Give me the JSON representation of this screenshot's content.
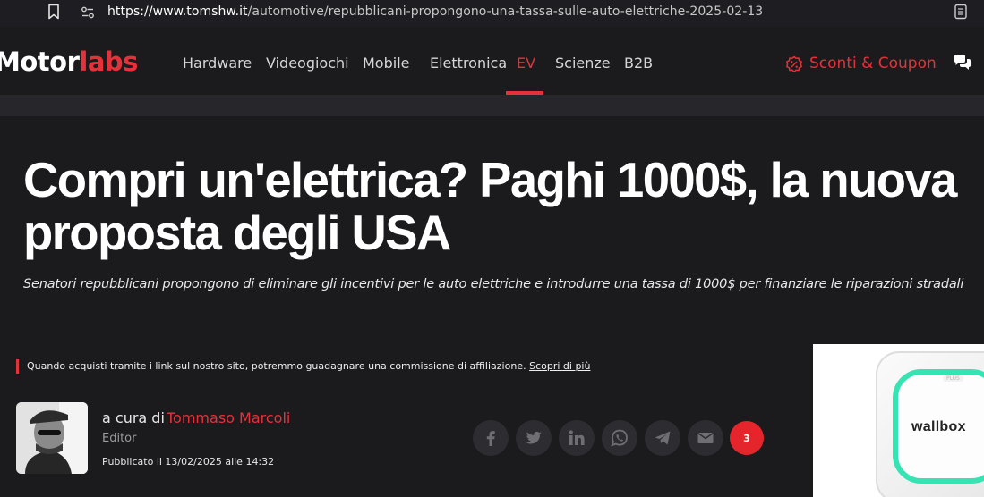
{
  "browser": {
    "url_host": "https://www.tomshw.it",
    "url_path": "/automotive/repubblicani-propongono-una-tassa-sulle-auto-elettriche-2025-02-13"
  },
  "nav": {
    "logo_part1": "Motor",
    "logo_part2": "labs",
    "items": [
      {
        "label": "Hardware"
      },
      {
        "label": "Videogiochi"
      },
      {
        "label": "Mobile"
      },
      {
        "label": "Elettronica"
      },
      {
        "label": "EV",
        "active": true
      },
      {
        "label": "Scienze"
      },
      {
        "label": "B2B"
      }
    ],
    "deals_label": "Sconti & Coupon"
  },
  "article": {
    "headline": "Compri un'elettrica? Paghi 1000$, la nuova proposta degli USA",
    "subtitle": "Senatori repubblicani propongono di eliminare gli incentivi per le auto elettriche e introdurre una tassa di 1000$ per finanziare le riparazioni stradali",
    "affiliate_text": "Quando acquisti tramite i link sul nostro sito, potremmo guadagnare una commissione di affiliazione. ",
    "affiliate_link": "Scopri di più",
    "byline_prefix": "a cura di",
    "author_name": "Tommaso Marcoli",
    "author_role": "Editor",
    "published": "Pubblicato il 13/02/2025 alle 14:32"
  },
  "share": {
    "icons": [
      "facebook-icon",
      "twitter-icon",
      "linkedin-icon",
      "whatsapp-icon",
      "telegram-icon",
      "email-icon"
    ],
    "comment_count": "3"
  },
  "ad": {
    "brand": "wallbox",
    "plus_label": "PLUS"
  },
  "colors": {
    "accent": "#e5323a",
    "background": "#1b1a1d",
    "share_button": "#2d2c31",
    "ad_ring": "#35e3b3"
  }
}
